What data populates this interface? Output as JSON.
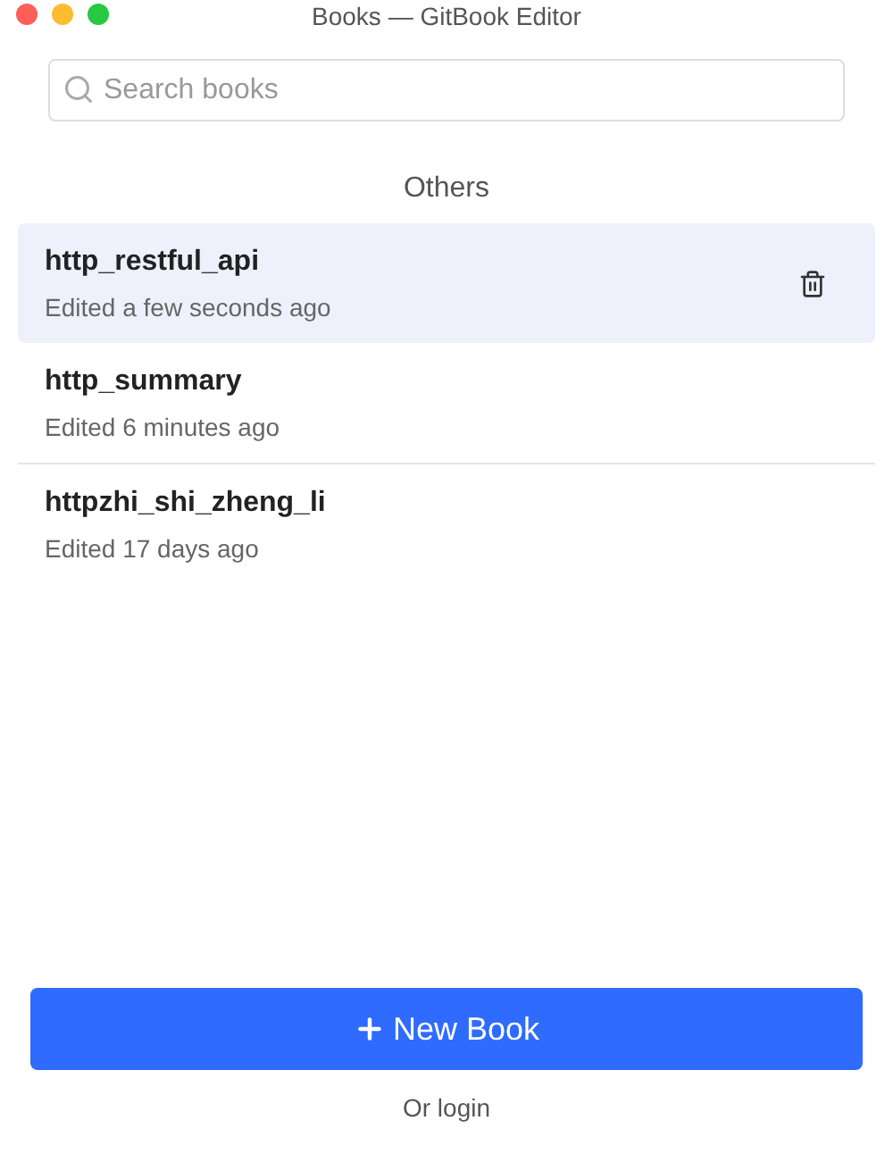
{
  "window": {
    "title": "Books — GitBook Editor"
  },
  "search": {
    "placeholder": "Search books"
  },
  "section_title": "Others",
  "books": [
    {
      "name": "http_restful_api",
      "edited": "Edited a few seconds ago",
      "selected": true
    },
    {
      "name": "http_summary",
      "edited": "Edited 6 minutes ago",
      "selected": false
    },
    {
      "name": "httpzhi_shi_zheng_li",
      "edited": "Edited 17 days ago",
      "selected": false
    }
  ],
  "new_book_button": {
    "label": "New Book"
  },
  "login_link": "Or login"
}
